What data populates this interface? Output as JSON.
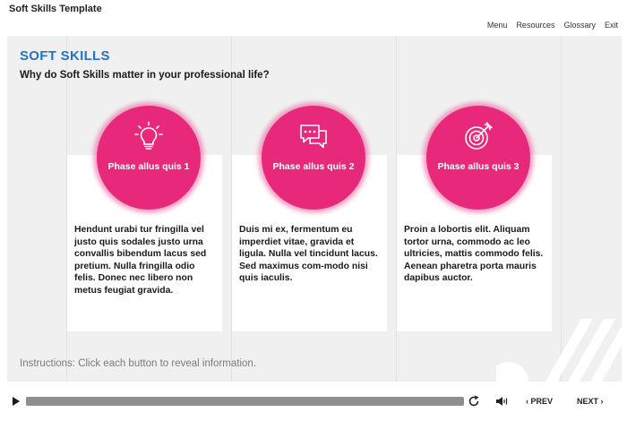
{
  "app": {
    "title": "Soft Skills Template"
  },
  "nav": {
    "menu": "Menu",
    "resources": "Resources",
    "glossary": "Glossary",
    "exit": "Exit"
  },
  "slide": {
    "title": "SOFT SKILLS",
    "subtitle": "Why do Soft Skills matter in your professional life?",
    "instructions": "Instructions: Click each button to reveal information.",
    "accent_color": "#e8287a",
    "title_color": "#2573c4",
    "phases": [
      {
        "label": "Phase allus quis 1",
        "icon": "lightbulb-icon",
        "text": "Hendunt urabi tur fringilla vel justo quis sodales justo urna convallis bibendum lacus sed pretium. Nulla fringilla odio felis. Donec nec libero non metus feugiat gravida."
      },
      {
        "label": "Phase allus quis 2",
        "icon": "chat-bubbles-icon",
        "text": "Duis mi ex, fermentum eu imperdiet vitae, gravida et ligula. Nulla vel tincidunt lacus. Sed maximus com-modo nisi quis iaculis."
      },
      {
        "label": "Phase allus quis 3",
        "icon": "target-arrow-icon",
        "text": "Proin a lobortis elit. Aliquam tortor urna, commodo ac leo ultricies, mattis commodo felis. Aenean pharetra porta mauris dapibus auctor."
      }
    ]
  },
  "player": {
    "prev": "‹ PREV",
    "next": "NEXT ›"
  }
}
